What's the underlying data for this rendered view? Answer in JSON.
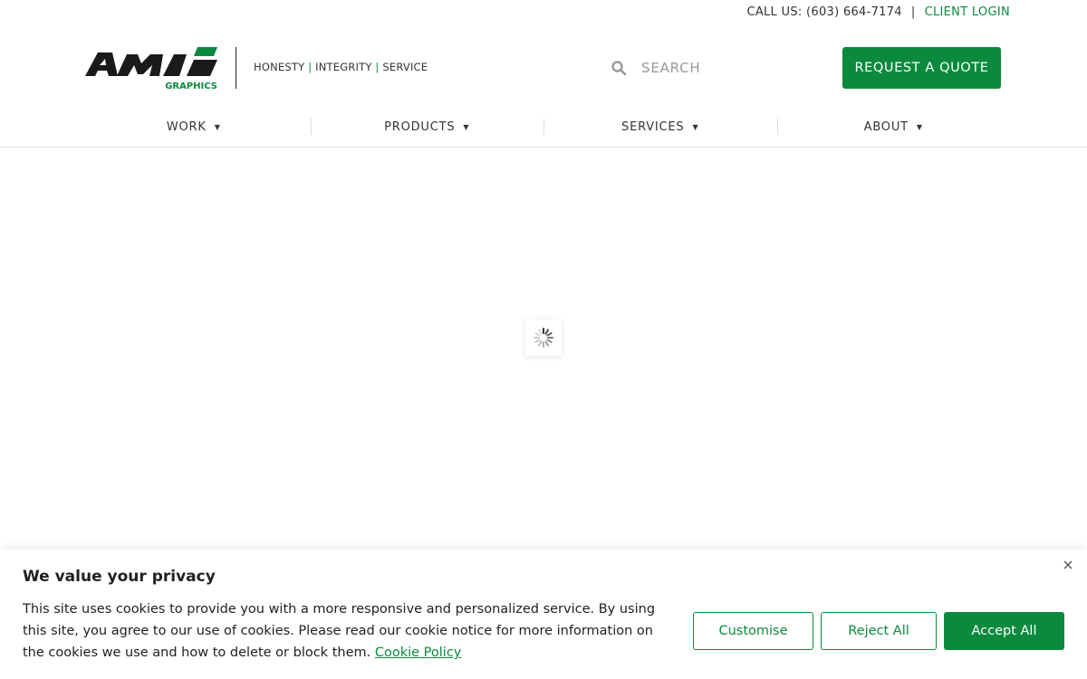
{
  "topbar": {
    "call_label": "CALL US: (603) 664-7174",
    "separator": "|",
    "login_label": "CLIENT LOGIN"
  },
  "brand": {
    "logo_text": "AMI",
    "logo_sub": "GRAPHICS",
    "tagline_1": "HONESTY",
    "tagline_2": "INTEGRITY",
    "tagline_3": "SERVICE",
    "tagline_sep": "|"
  },
  "search": {
    "placeholder": "SEARCH",
    "icon": "search-icon"
  },
  "header": {
    "quote_label": "REQUEST A QUOTE"
  },
  "nav": {
    "items": [
      {
        "label": "WORK"
      },
      {
        "label": "PRODUCTS"
      },
      {
        "label": "SERVICES"
      },
      {
        "label": "ABOUT"
      }
    ]
  },
  "cookie": {
    "title": "We value your privacy",
    "text": "This site uses cookies to provide you with a more responsive and personalized service. By using this site, you agree to our use of cookies. Please read our cookie notice for more information on the cookies we use and how to delete or block them.",
    "link_label": "Cookie Policy",
    "customise_label": "Customise",
    "reject_label": "Reject All",
    "accept_label": "Accept All"
  },
  "colors": {
    "accent": "#0b8a3e",
    "text": "#333333",
    "logo_black": "#1a1a1a"
  }
}
